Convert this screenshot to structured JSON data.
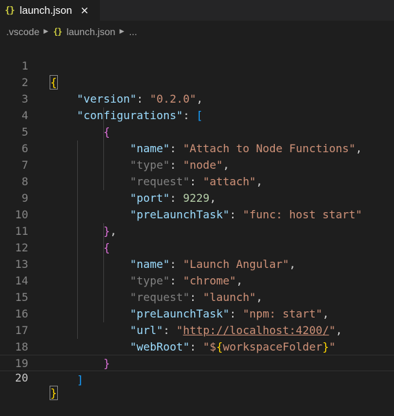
{
  "tab": {
    "icon": "{}",
    "label": "launch.json",
    "close": "×"
  },
  "breadcrumb": {
    "folder": ".vscode",
    "icon": "{}",
    "file": "launch.json",
    "ellipsis": "..."
  },
  "editor": {
    "line_numbers": [
      "1",
      "2",
      "3",
      "4",
      "5",
      "6",
      "7",
      "8",
      "9",
      "10",
      "11",
      "12",
      "13",
      "14",
      "15",
      "16",
      "17",
      "18",
      "19",
      "20"
    ],
    "current_line": "20",
    "lines": {
      "l1": {
        "brace": "{"
      },
      "l2": {
        "key": "\"version\"",
        "colon": ": ",
        "value": "\"0.2.0\"",
        "comma": ","
      },
      "l3": {
        "key": "\"configurations\"",
        "colon": ": ",
        "bracket": "["
      },
      "l4": {
        "brace": "{"
      },
      "l5": {
        "key": "\"name\"",
        "colon": ": ",
        "value": "\"Attach to Node Functions\"",
        "comma": ","
      },
      "l6": {
        "key": "\"type\"",
        "colon": ": ",
        "value": "\"node\"",
        "comma": ","
      },
      "l7": {
        "key": "\"request\"",
        "colon": ": ",
        "value": "\"attach\"",
        "comma": ","
      },
      "l8": {
        "key": "\"port\"",
        "colon": ": ",
        "value": "9229",
        "comma": ","
      },
      "l9": {
        "key": "\"preLaunchTask\"",
        "colon": ": ",
        "value": "\"func: host start\""
      },
      "l10": {
        "brace": "}",
        "comma": ","
      },
      "l11": {
        "brace": "{"
      },
      "l12": {
        "key": "\"name\"",
        "colon": ": ",
        "value": "\"Launch Angular\"",
        "comma": ","
      },
      "l13": {
        "key": "\"type\"",
        "colon": ": ",
        "value": "\"chrome\"",
        "comma": ","
      },
      "l14": {
        "key": "\"request\"",
        "colon": ": ",
        "value": "\"launch\"",
        "comma": ","
      },
      "l15": {
        "key": "\"preLaunchTask\"",
        "colon": ": ",
        "value": "\"npm: start\"",
        "comma": ","
      },
      "l16": {
        "key": "\"url\"",
        "colon": ": ",
        "quote_open": "\"",
        "value": "http://localhost:4200/",
        "quote_close": "\"",
        "comma": ","
      },
      "l17": {
        "key": "\"webRoot\"",
        "colon": ": ",
        "value_pre": "\"$",
        "var_open": "{",
        "var_name": "workspaceFolder",
        "var_close": "}",
        "value_post": "\""
      },
      "l18": {
        "brace": "}"
      },
      "l19": {
        "bracket": "]"
      },
      "l20": {
        "brace": "}"
      }
    }
  },
  "colors": {
    "background": "#1e1e1e",
    "tabbar": "#252526",
    "key": "#9cdcfe",
    "dim_key": "#808080",
    "string": "#ce9178",
    "number": "#b5cea8",
    "bracket_level1": "#ffd700",
    "bracket_level2": "#179fff",
    "bracket_level3": "#da70d6",
    "json_icon": "#cbcb41"
  }
}
